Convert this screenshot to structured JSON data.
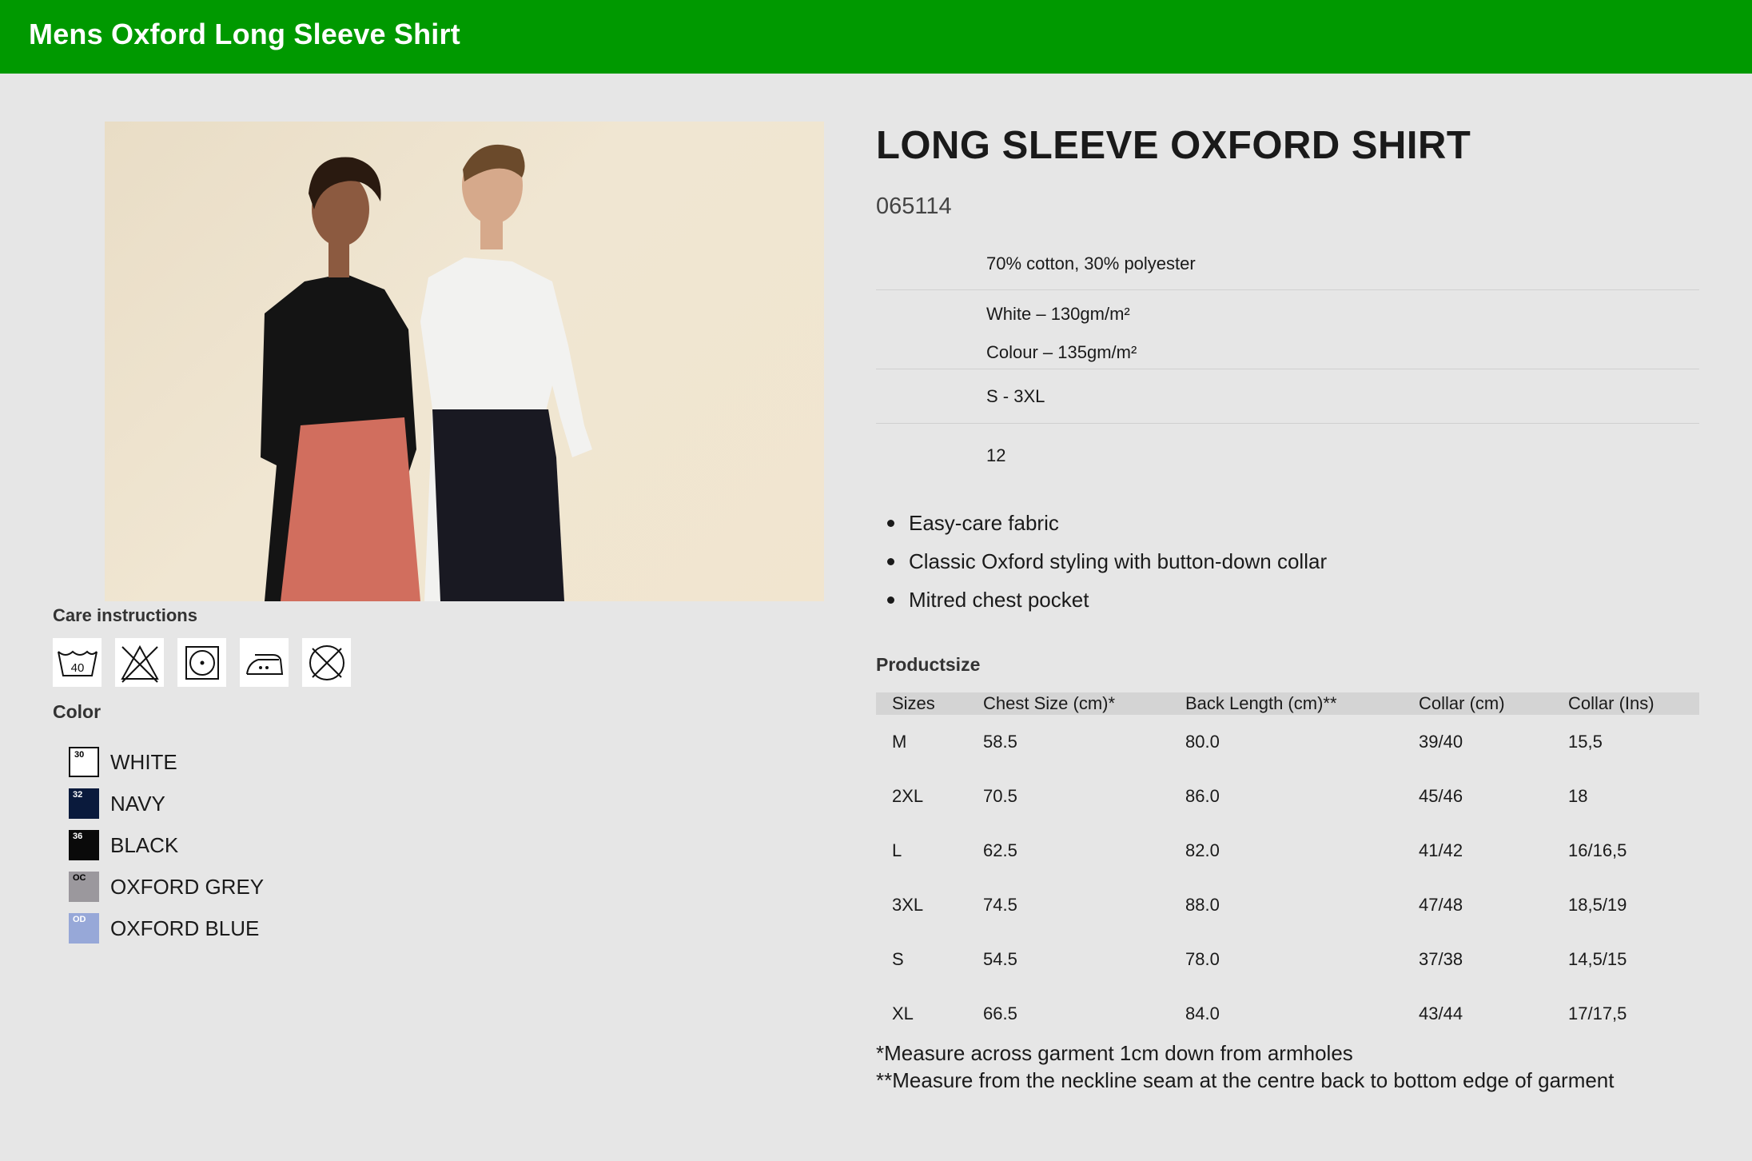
{
  "header": {
    "title": "Mens Oxford Long Sleeve Shirt"
  },
  "product": {
    "title": "LONG SLEEVE OXFORD SHIRT",
    "code": "065114",
    "specs": {
      "material": "70% cotton, 30% polyester",
      "weight_white": "White – 130gm/m²",
      "weight_colour": "Colour – 135gm/m²",
      "sizes": "S - 3XL",
      "pack": "12"
    },
    "features": [
      "Easy-care fabric",
      "Classic Oxford styling with button-down collar",
      "Mitred chest pocket"
    ]
  },
  "care": {
    "heading": "Care instructions",
    "wash_temp": "40",
    "icons": [
      "wash-40-icon",
      "no-bleach-icon",
      "tumble-dry-icon",
      "iron-medium-icon",
      "no-dry-clean-icon"
    ]
  },
  "colors": {
    "heading": "Color",
    "items": [
      {
        "code": "30",
        "name": "WHITE",
        "hex": "#ffffff",
        "code_color": "#000000"
      },
      {
        "code": "32",
        "name": "NAVY",
        "hex": "#0a1a3c",
        "code_color": "#ffffff"
      },
      {
        "code": "36",
        "name": "BLACK",
        "hex": "#0a0a0a",
        "code_color": "#ffffff"
      },
      {
        "code": "OC",
        "name": "OXFORD GREY",
        "hex": "#9b989d",
        "code_color": "#000000"
      },
      {
        "code": "OD",
        "name": "OXFORD BLUE",
        "hex": "#97a8d8",
        "code_color": "#ffffff"
      }
    ]
  },
  "size_table": {
    "heading": "Productsize",
    "columns": [
      "Sizes",
      "Chest Size (cm)*",
      "Back Length (cm)**",
      "Collar (cm)",
      "Collar (Ins)"
    ],
    "rows": [
      [
        "M",
        "58.5",
        "80.0",
        "39/40",
        "15,5"
      ],
      [
        "2XL",
        "70.5",
        "86.0",
        "45/46",
        "18"
      ],
      [
        "L",
        "62.5",
        "82.0",
        "41/42",
        "16/16,5"
      ],
      [
        "3XL",
        "74.5",
        "88.0",
        "47/48",
        "18,5/19"
      ],
      [
        "S",
        "54.5",
        "78.0",
        "37/38",
        "14,5/15"
      ],
      [
        "XL",
        "66.5",
        "84.0",
        "43/44",
        "17/17,5"
      ]
    ],
    "footnotes": [
      "*Measure across garment 1cm down from armholes",
      "**Measure from the neckline seam at the centre back to bottom edge of garment"
    ]
  },
  "theme": {
    "accent": "#009900",
    "background": "#e6e6e6"
  }
}
